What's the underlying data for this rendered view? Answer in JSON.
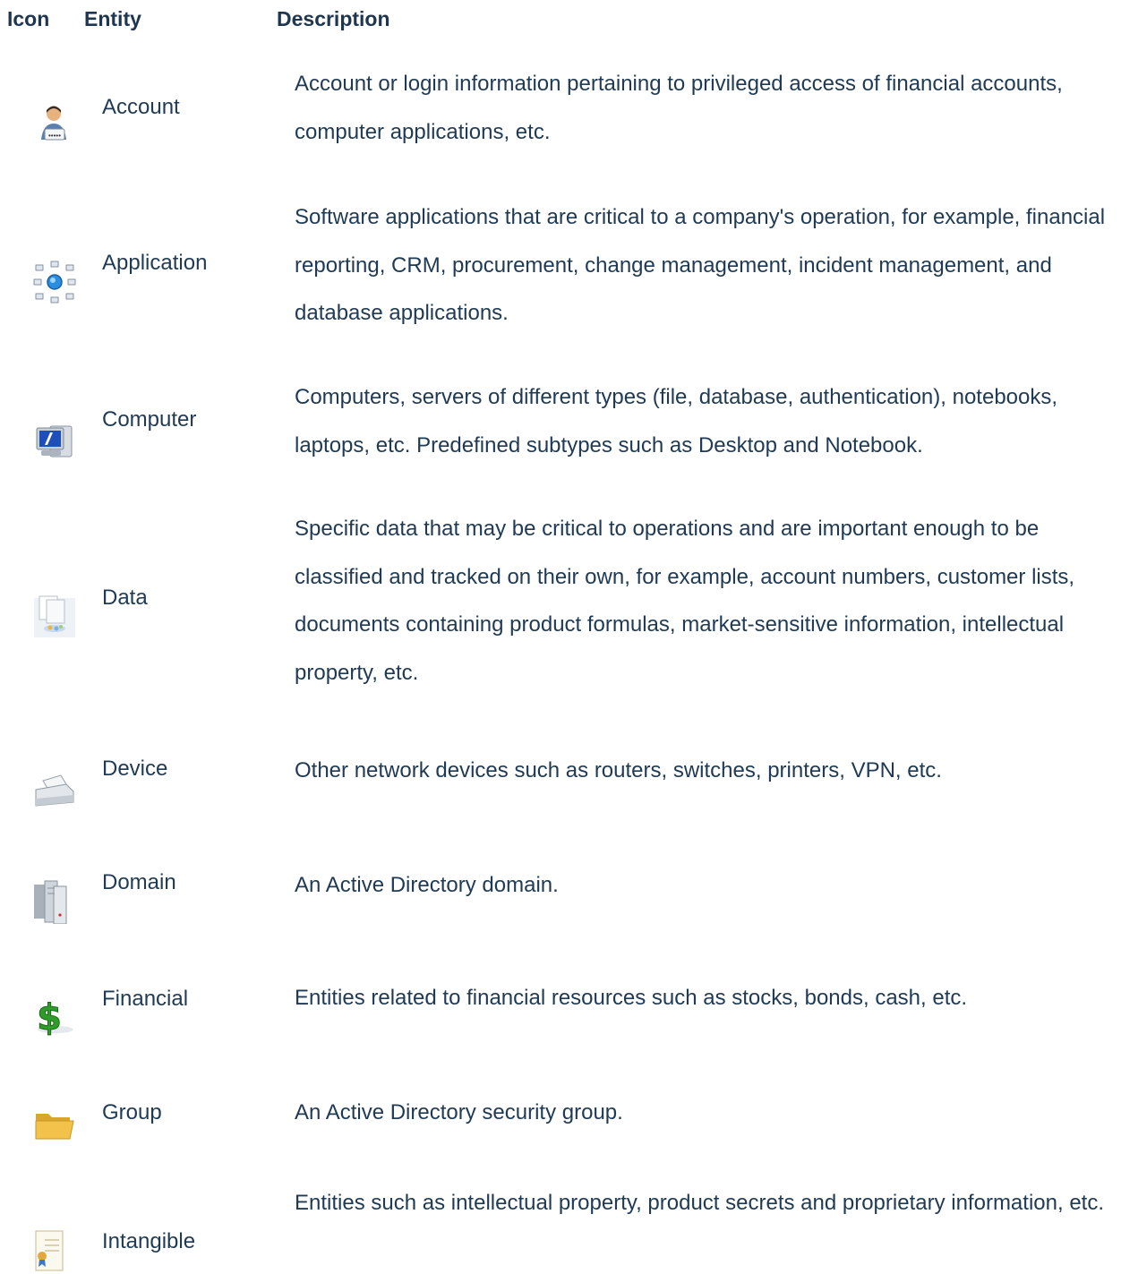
{
  "header": {
    "icon": "Icon",
    "entity": "Entity",
    "description": "Description"
  },
  "rows": [
    {
      "icon": "account-icon",
      "entity": "Account",
      "description": "Account or login information pertaining to privileged access of financial accounts, computer applications, etc."
    },
    {
      "icon": "application-icon",
      "entity": "Application",
      "description": "Software applications that are critical to a company's operation, for example, financial reporting, CRM, procurement, change management, incident management, and database applications."
    },
    {
      "icon": "computer-icon",
      "entity": "Computer",
      "description": "Computers, servers of different types (file, database, authentication), notebooks, laptops, etc. Predefined subtypes such as Desktop and Notebook."
    },
    {
      "icon": "data-icon",
      "entity": "Data",
      "description": "Specific data that may be critical to operations and are important enough to be classified and tracked on their own, for example, account numbers, customer lists, documents containing product formulas, market-sensitive information, intellectual property, etc."
    },
    {
      "icon": "device-icon",
      "entity": "Device",
      "description": "Other network devices such as routers, switches, printers, VPN, etc."
    },
    {
      "icon": "domain-icon",
      "entity": "Domain",
      "description": "An Active Directory domain."
    },
    {
      "icon": "financial-icon",
      "entity": "Financial",
      "description": "Entities related to financial resources such as stocks, bonds, cash, etc."
    },
    {
      "icon": "group-icon",
      "entity": "Group",
      "description": "An Active Directory security group."
    },
    {
      "icon": "intangible-icon",
      "entity": "Intangible",
      "description": "Entities such as intellectual property, product secrets and proprietary information, etc."
    }
  ]
}
